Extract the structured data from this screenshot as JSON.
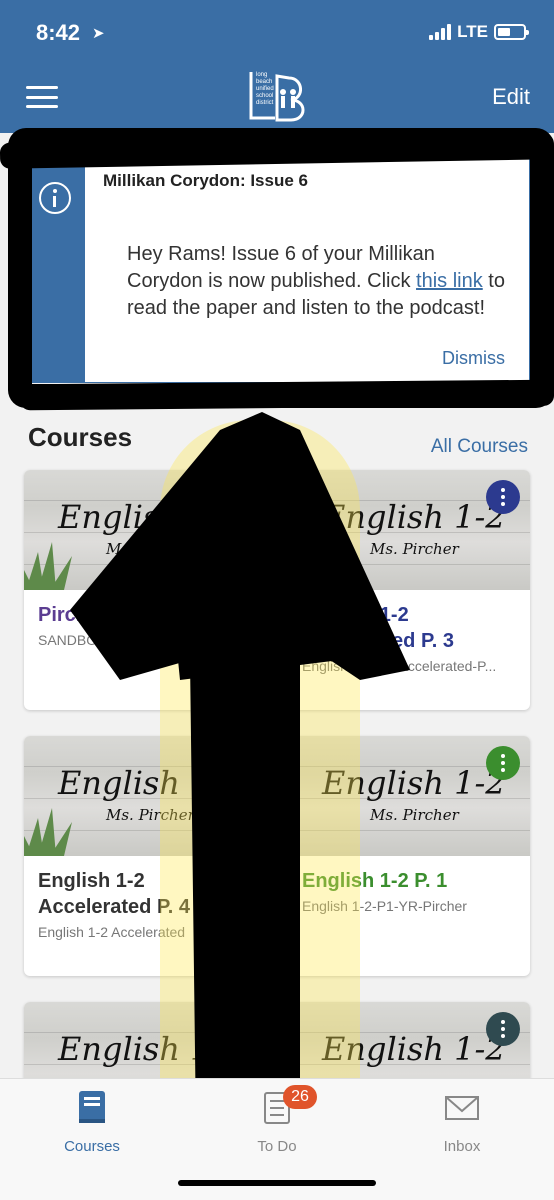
{
  "status_bar": {
    "time": "8:42",
    "network": "LTE"
  },
  "header": {
    "logo_text": "long beach unified school district",
    "edit_label": "Edit"
  },
  "announcement": {
    "title": "Millikan Corydon: Issue 6",
    "body_before": "Hey Rams! Issue 6 of your Millikan Corydon is now published. Click ",
    "link_text": "this link",
    "body_after": " to read the paper and listen to the podcast!",
    "dismiss_label": "Dismiss"
  },
  "courses_section": {
    "title": "Courses",
    "all_courses_label": "All Courses"
  },
  "courses": [
    {
      "sign_title": "English 1-2",
      "sign_sub": "Ms. Pircher",
      "name": "Pircher's English 1-2",
      "code": "SANDBOX KATHRYN PIRCHER",
      "color": "#5b3d91"
    },
    {
      "sign_title": "English 1-2",
      "sign_sub": "Ms. Pircher",
      "name": "English 1-2 Accelerated P. 3",
      "code": "English 1-2-P3-Accelerated-P...",
      "color": "#2c3a8f"
    },
    {
      "sign_title": "English 1-2",
      "sign_sub": "Ms. Pircher",
      "name": "English 1-2 Accelerated P. 4",
      "code": "English 1-2 Accelerated",
      "color": "#333333"
    },
    {
      "sign_title": "English 1-2",
      "sign_sub": "Ms. Pircher",
      "name": "English 1-2 P. 1",
      "code": "English 1-2-P1-YR-Pircher",
      "color": "#3b8e2e"
    },
    {
      "sign_title": "English 1-2",
      "sign_sub": "",
      "name": "",
      "code": "",
      "color": "#333333"
    },
    {
      "sign_title": "English 1-2",
      "sign_sub": "",
      "name": "",
      "code": "",
      "color": "#2f4a50"
    }
  ],
  "tabbar": {
    "tabs": [
      {
        "label": "Courses",
        "icon": "book-icon"
      },
      {
        "label": "To Do",
        "icon": "checklist-icon",
        "badge": "26"
      },
      {
        "label": "Inbox",
        "icon": "envelope-icon"
      }
    ]
  },
  "colors": {
    "brand": "#3a6ea5",
    "badge": "#e0542b",
    "highlight": "#ffe94d"
  }
}
